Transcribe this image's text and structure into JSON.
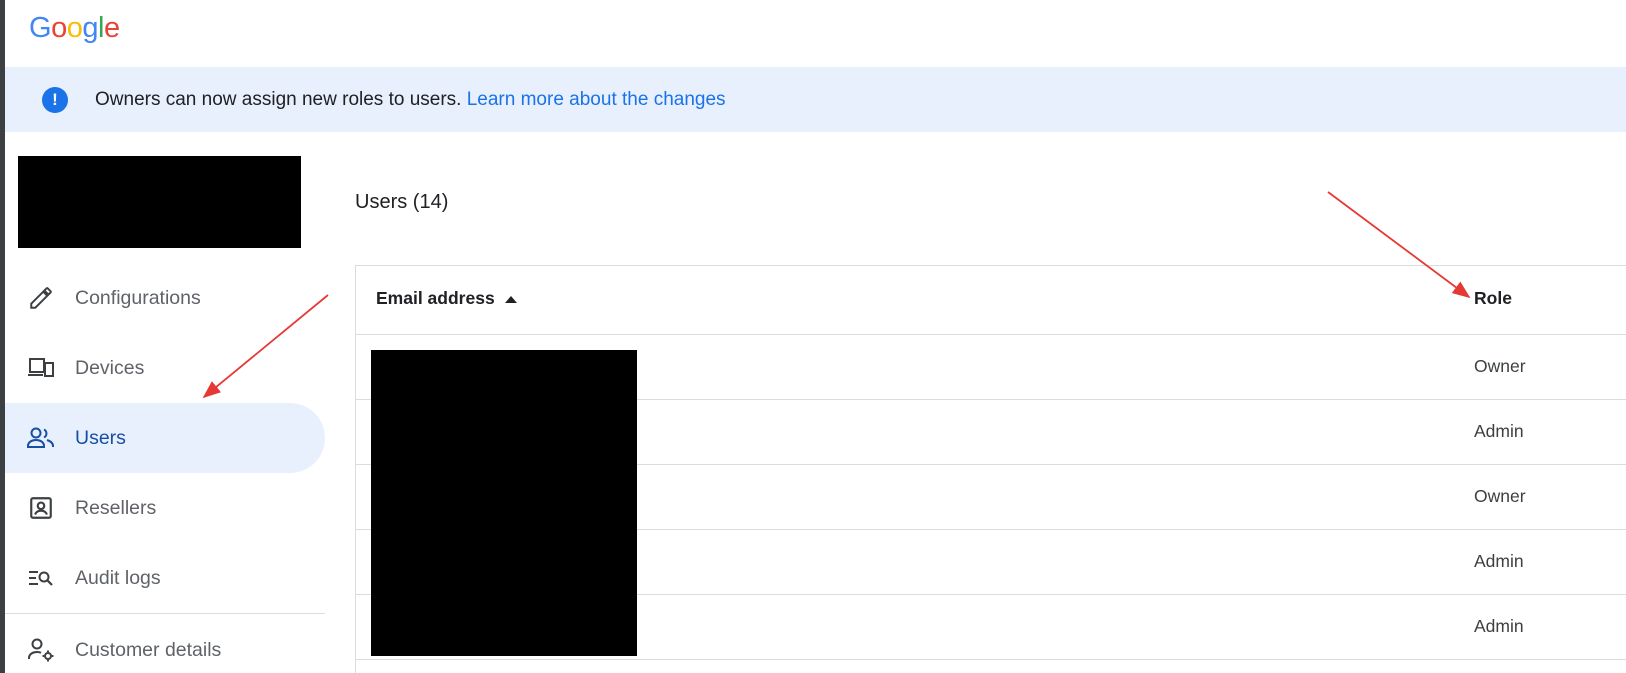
{
  "brand": {
    "logo_letters": [
      {
        "char": "G",
        "color": "#4285f4"
      },
      {
        "char": "o",
        "color": "#ea4335"
      },
      {
        "char": "o",
        "color": "#fbbc05"
      },
      {
        "char": "g",
        "color": "#4285f4"
      },
      {
        "char": "l",
        "color": "#34a853"
      },
      {
        "char": "e",
        "color": "#ea4335"
      }
    ],
    "logo_text": "Google"
  },
  "banner": {
    "icon": "info-icon",
    "icon_glyph": "!",
    "message": "Owners can now assign new roles to users. ",
    "link_text": "Learn more about the changes"
  },
  "sidebar": {
    "items": [
      {
        "label": "Configurations",
        "icon": "pencil-icon",
        "active": false
      },
      {
        "label": "Devices",
        "icon": "devices-icon",
        "active": false
      },
      {
        "label": "Users",
        "icon": "users-icon",
        "active": true
      },
      {
        "label": "Resellers",
        "icon": "reseller-badge-icon",
        "active": false
      },
      {
        "label": "Audit logs",
        "icon": "audit-search-icon",
        "active": false
      },
      {
        "label": "Customer details",
        "icon": "customer-settings-icon",
        "active": false
      }
    ]
  },
  "main": {
    "title": "Users (14)",
    "table": {
      "columns": {
        "email": "Email address",
        "role": "Role"
      },
      "sort": {
        "column": "email",
        "direction": "ascending",
        "icon": "sort-ascending-icon"
      },
      "rows": [
        {
          "role": "Owner"
        },
        {
          "role": "Admin"
        },
        {
          "role": "Owner"
        },
        {
          "role": "Admin"
        },
        {
          "role": "Admin"
        }
      ]
    }
  },
  "colors": {
    "accent": "#1a73e8",
    "banner_bg": "#e8f0fe",
    "active_text": "#174ea6",
    "annotation_arrow": "#e53935"
  }
}
